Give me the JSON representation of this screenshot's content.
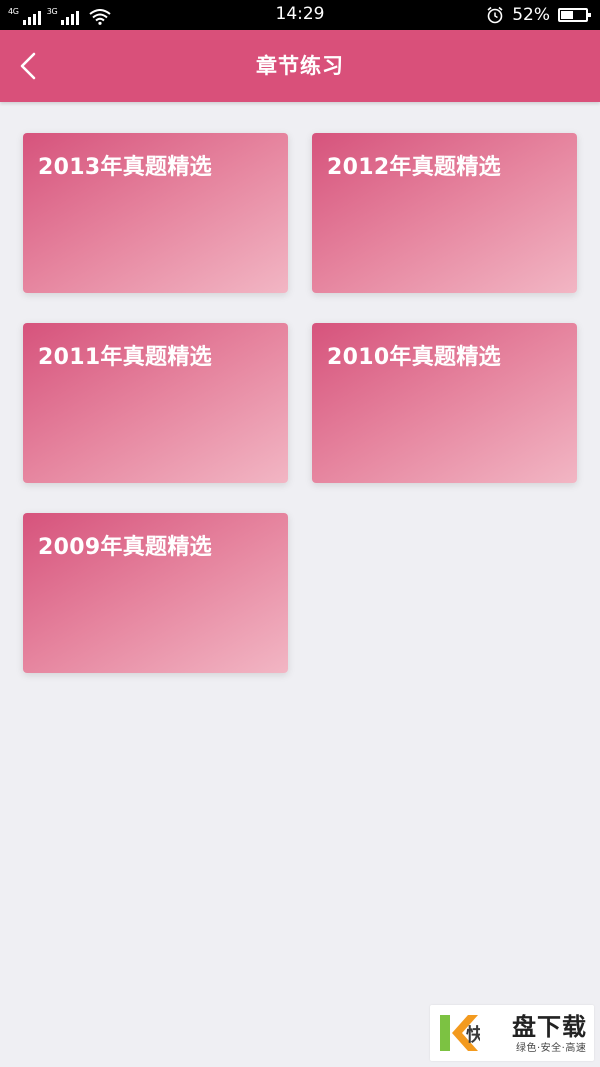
{
  "status_bar": {
    "net1": "4G",
    "net2": "3G",
    "time": "14:29",
    "battery": "52%",
    "battery_level": 0.52,
    "icons": [
      "signal-icon",
      "wifi-icon",
      "alarm-icon",
      "battery-icon"
    ]
  },
  "header": {
    "title": "章节练习",
    "background": "#d9507a",
    "back_icon": "chevron-left-icon"
  },
  "cards": [
    {
      "label": "2013年真题精选"
    },
    {
      "label": "2012年真题精选"
    },
    {
      "label": "2011年真题精选"
    },
    {
      "label": "2010年真题精选"
    },
    {
      "label": "2009年真题精选"
    }
  ],
  "watermark": {
    "logo_char": "快",
    "name": "盘下载",
    "tagline": "绿色·安全·高速"
  }
}
